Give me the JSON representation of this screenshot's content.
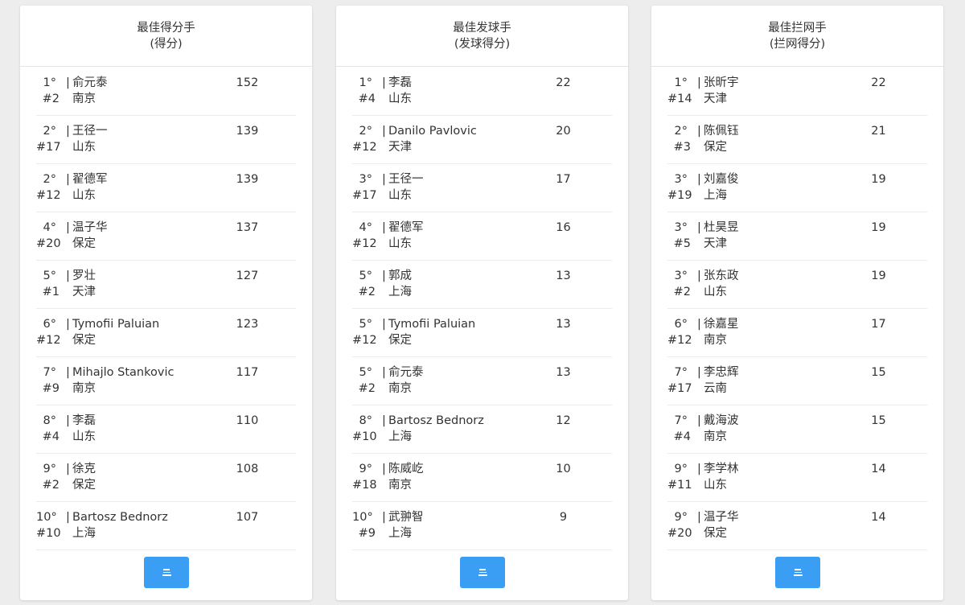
{
  "colors": {
    "page_background": "#ededed",
    "card_background": "#ffffff",
    "button_accent": "#3b9ef5",
    "text": "#333333"
  },
  "icons": {
    "more_button": "menu-lines-icon"
  },
  "cards": [
    {
      "title": "最佳得分手",
      "subtitle": "(得分)",
      "rows": [
        {
          "rank": "1°",
          "name": "俞元泰",
          "number": "#2",
          "team": "南京",
          "value": "152"
        },
        {
          "rank": "2°",
          "name": "王径一",
          "number": "#17",
          "team": "山东",
          "value": "139"
        },
        {
          "rank": "2°",
          "name": "翟德军",
          "number": "#12",
          "team": "山东",
          "value": "139"
        },
        {
          "rank": "4°",
          "name": "温子华",
          "number": "#20",
          "team": "保定",
          "value": "137"
        },
        {
          "rank": "5°",
          "name": "罗壮",
          "number": "#1",
          "team": "天津",
          "value": "127"
        },
        {
          "rank": "6°",
          "name": "Tymofii Paluian",
          "number": "#12",
          "team": "保定",
          "value": "123"
        },
        {
          "rank": "7°",
          "name": "Mihajlo Stankovic",
          "number": "#9",
          "team": "南京",
          "value": "117"
        },
        {
          "rank": "8°",
          "name": "李磊",
          "number": "#4",
          "team": "山东",
          "value": "110"
        },
        {
          "rank": "9°",
          "name": "徐克",
          "number": "#2",
          "team": "保定",
          "value": "108"
        },
        {
          "rank": "10°",
          "name": "Bartosz Bednorz",
          "number": "#10",
          "team": "上海",
          "value": "107"
        }
      ]
    },
    {
      "title": "最佳发球手",
      "subtitle": "(发球得分)",
      "rows": [
        {
          "rank": "1°",
          "name": "李磊",
          "number": "#4",
          "team": "山东",
          "value": "22"
        },
        {
          "rank": "2°",
          "name": "Danilo Pavlovic",
          "number": "#12",
          "team": "天津",
          "value": "20"
        },
        {
          "rank": "3°",
          "name": "王径一",
          "number": "#17",
          "team": "山东",
          "value": "17"
        },
        {
          "rank": "4°",
          "name": "翟德军",
          "number": "#12",
          "team": "山东",
          "value": "16"
        },
        {
          "rank": "5°",
          "name": "郭成",
          "number": "#2",
          "team": "上海",
          "value": "13"
        },
        {
          "rank": "5°",
          "name": "Tymofii Paluian",
          "number": "#12",
          "team": "保定",
          "value": "13"
        },
        {
          "rank": "5°",
          "name": "俞元泰",
          "number": "#2",
          "team": "南京",
          "value": "13"
        },
        {
          "rank": "8°",
          "name": "Bartosz Bednorz",
          "number": "#10",
          "team": "上海",
          "value": "12"
        },
        {
          "rank": "9°",
          "name": "陈威屹",
          "number": "#18",
          "team": "南京",
          "value": "10"
        },
        {
          "rank": "10°",
          "name": "武翀智",
          "number": "#9",
          "team": "上海",
          "value": "9"
        }
      ]
    },
    {
      "title": "最佳拦网手",
      "subtitle": "(拦网得分)",
      "rows": [
        {
          "rank": "1°",
          "name": "张昕宇",
          "number": "#14",
          "team": "天津",
          "value": "22"
        },
        {
          "rank": "2°",
          "name": "陈佩钰",
          "number": "#3",
          "team": "保定",
          "value": "21"
        },
        {
          "rank": "3°",
          "name": "刘嘉俊",
          "number": "#19",
          "team": "上海",
          "value": "19"
        },
        {
          "rank": "3°",
          "name": "杜昊昱",
          "number": "#5",
          "team": "天津",
          "value": "19"
        },
        {
          "rank": "3°",
          "name": "张东政",
          "number": "#2",
          "team": "山东",
          "value": "19"
        },
        {
          "rank": "6°",
          "name": "徐嘉星",
          "number": "#12",
          "team": "南京",
          "value": "17"
        },
        {
          "rank": "7°",
          "name": "李忠辉",
          "number": "#17",
          "team": "云南",
          "value": "15"
        },
        {
          "rank": "7°",
          "name": "戴海波",
          "number": "#4",
          "team": "南京",
          "value": "15"
        },
        {
          "rank": "9°",
          "name": "李学林",
          "number": "#11",
          "team": "山东",
          "value": "14"
        },
        {
          "rank": "9°",
          "name": "温子华",
          "number": "#20",
          "team": "保定",
          "value": "14"
        }
      ]
    }
  ]
}
